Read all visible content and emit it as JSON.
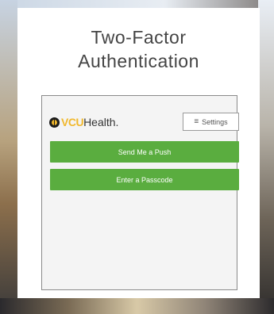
{
  "title": {
    "line1": "Two-Factor",
    "line2": "Authentication"
  },
  "brand": {
    "icon": "vcu-ram-icon",
    "name_highlight": "VCU",
    "name_rest": "Health."
  },
  "settings": {
    "icon": "menu-icon",
    "label": "Settings"
  },
  "actions": {
    "push_label": "Send Me a Push",
    "passcode_label": "Enter a Passcode"
  },
  "colors": {
    "button_green": "#5aad3f",
    "brand_gold": "#f1b82d"
  }
}
